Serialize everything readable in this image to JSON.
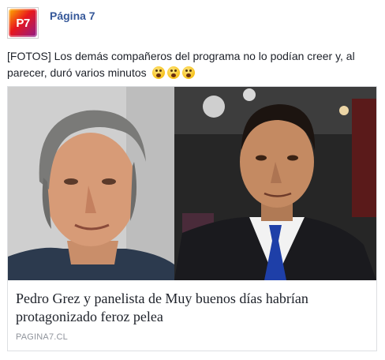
{
  "post": {
    "page_name": "Página 7",
    "avatar_text": "P7",
    "caption": "[FOTOS] Los demás compañeros del programa no lo podían creer y, al parecer, duró varios minutos",
    "emojis": [
      "astonished-emoji-icon",
      "astonished-emoji-icon",
      "astonished-emoji-icon"
    ]
  },
  "link": {
    "headline": "Pedro Grez y panelista de Muy buenos días habrían protagonizado feroz pelea",
    "domain": "PAGINA7.CL"
  },
  "colors": {
    "page_name": "#365899",
    "text": "#1d2129",
    "domain": "#90949c",
    "border": "#dddfe2"
  }
}
